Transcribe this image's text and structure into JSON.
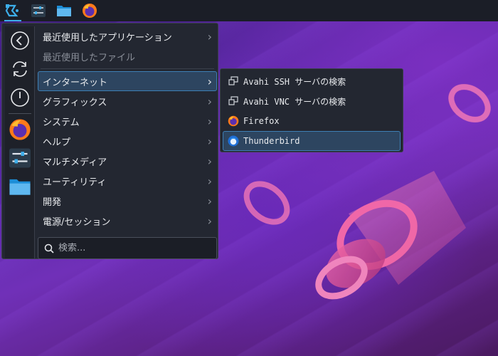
{
  "panel": {
    "items": [
      "app-launcher",
      "system-settings",
      "file-manager",
      "firefox"
    ]
  },
  "favorites": [
    "back",
    "restart",
    "power",
    "firefox",
    "system-settings",
    "file-manager"
  ],
  "menu": {
    "categories": [
      {
        "label": "最近使用したアプリケーション",
        "state": "normal"
      },
      {
        "label": "最近使用したファイル",
        "state": "disabled"
      },
      {
        "label": "インターネット",
        "state": "selected"
      },
      {
        "label": "グラフィックス",
        "state": "normal"
      },
      {
        "label": "システム",
        "state": "normal"
      },
      {
        "label": "ヘルプ",
        "state": "normal"
      },
      {
        "label": "マルチメディア",
        "state": "normal"
      },
      {
        "label": "ユーティリティ",
        "state": "normal"
      },
      {
        "label": "開発",
        "state": "normal"
      },
      {
        "label": "電源/セッション",
        "state": "normal"
      }
    ],
    "search_placeholder": "検索..."
  },
  "submenu": {
    "items": [
      {
        "label": "Avahi SSH サーバの検索",
        "icon": "network-icon"
      },
      {
        "label": "Avahi VNC サーバの検索",
        "icon": "network-icon"
      },
      {
        "label": "Firefox",
        "icon": "firefox-icon"
      },
      {
        "label": "Thunderbird",
        "icon": "thunderbird-icon"
      }
    ],
    "selected_index": 3
  },
  "colors": {
    "accent": "#3daee9",
    "selection": "#2d4560",
    "menu_bg": "#232731",
    "panel_bg": "#1b1e27"
  }
}
